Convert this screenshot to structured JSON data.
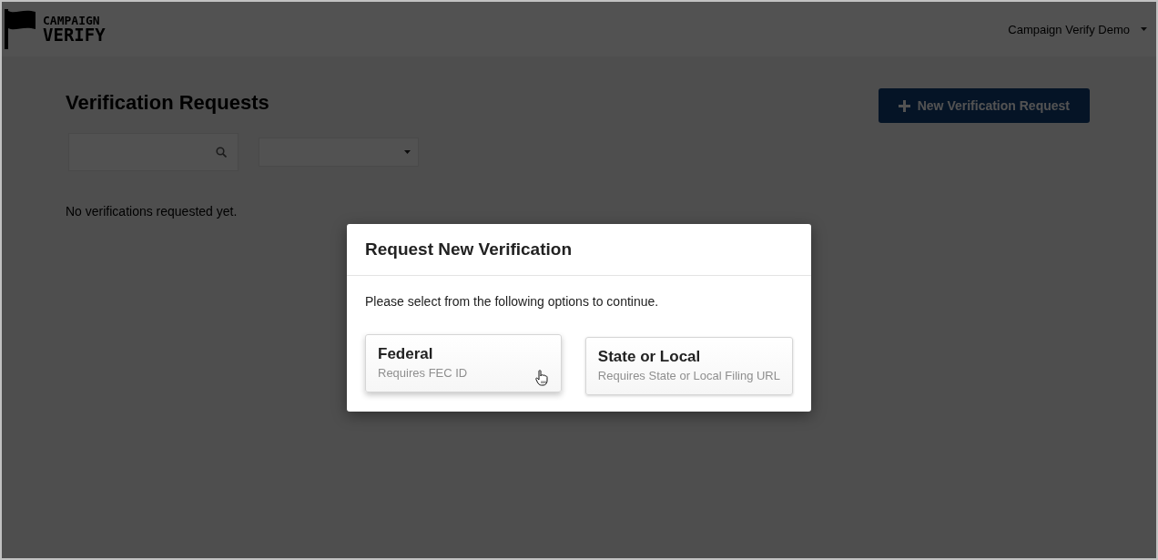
{
  "header": {
    "logo": {
      "line_1": "CAMPAIGN",
      "line_2": "VERIFY"
    },
    "user_menu": {
      "label": "Campaign Verify Demo"
    }
  },
  "page": {
    "title": "Verification Requests",
    "new_button": {
      "label": "New Verification Request"
    },
    "empty_message": "No verifications requested yet."
  },
  "modal": {
    "open": true,
    "title": "Request New Verification",
    "prompt": "Please select from the following options to continue.",
    "options": [
      {
        "title": "Federal",
        "subtitle": "Requires FEC ID",
        "hovered": true
      },
      {
        "title": "State or Local",
        "subtitle": "Requires State or Local Filing URL",
        "hovered": false
      }
    ]
  }
}
